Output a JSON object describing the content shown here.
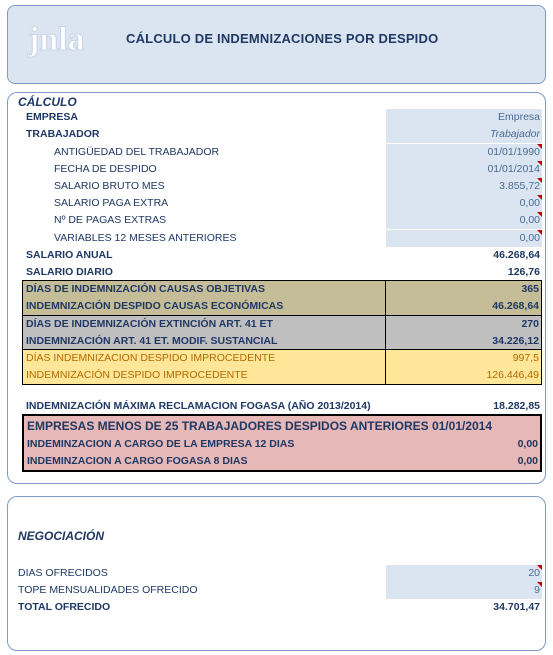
{
  "header": {
    "logo_text": "jnla",
    "title": "CÁLCULO DE INDEMNIZACIONES POR DESPIDO"
  },
  "calc": {
    "title": "CÁLCULO",
    "empresa_label": "EMPRESA",
    "empresa_value": "Empresa",
    "trabajador_label": "TRABAJADOR",
    "trabajador_value": "Trabajador",
    "antiguedad_label": "ANTIGÜEDAD DEL TRABAJADOR",
    "antiguedad_value": "01/01/1990",
    "fecha_label": "FECHA DE DESPIDO",
    "fecha_value": "01/01/2014",
    "salario_bruto_label": "SALARIO BRUTO MES",
    "salario_bruto_value": "3.855,72",
    "paga_extra_label": "SALARIO PAGA EXTRA",
    "paga_extra_value": "0,00",
    "num_pagas_label": "Nº DE PAGAS EXTRAS",
    "num_pagas_value": "0,00",
    "variables_label": "VARIABLES 12 MESES ANTERIORES",
    "variables_value": "0,00",
    "salario_anual_label": "SALARIO ANUAL",
    "salario_anual_value": "46.268,64",
    "salario_diario_label": "SALARIO DIARIO",
    "salario_diario_value": "126,76",
    "objetivas_dias_label": "DÍAS DE INDEMNIZACIÓN CAUSAS OBJETIVAS",
    "objetivas_dias_value": "365",
    "objetivas_ind_label": "INDEMNIZACIÓN DESPIDO CAUSAS ECONÓMICAS",
    "objetivas_ind_value": "46.268,64",
    "art41_dias_label": "DÍAS DE INDEMNIZACIÓN EXTINCIÓN ART. 41 ET",
    "art41_dias_value": "270",
    "art41_ind_label": "INDEMNIZACIÓN ART. 41 ET. MODIF. SUSTANCIAL",
    "art41_ind_value": "34.226,12",
    "improc_dias_label": "DÍAS INDEMNIZACION DESPIDO IMPROCEDENTE",
    "improc_dias_value": "997,5",
    "improc_ind_label": "INDEMNIZACIÓN DESPIDO IMPROCEDENTE",
    "improc_ind_value": "126.446,49",
    "fogasa_label": "INDEMNIZACIÓN MÁXIMA RECLAMACION FOGASA (AÑO 2013/2014)",
    "fogasa_value": "18.282,85",
    "pequenas_title": "EMPRESAS MENOS DE 25 TRABAJADORES DESPIDOS ANTERIORES 01/01/2014",
    "pequenas_empresa_label": "INDEMINZACION A CARGO DE LA EMPRESA 12 DIAS",
    "pequenas_empresa_value": "0,00",
    "pequenas_fogasa_label": "INDEMINZACION A CARGO FOGASA 8 DIAS",
    "pequenas_fogasa_value": "0,00"
  },
  "negociacion": {
    "title": "NEGOCIACIÓN",
    "dias_label": "DIAS OFRECIDOS",
    "dias_value": "20",
    "tope_label": "TOPE MENSUALIDADES OFRECIDO",
    "tope_value": "9",
    "total_label": "TOTAL OFRECIDO",
    "total_value": "34.701,47"
  },
  "colors": {
    "accent": "#1f3864",
    "input_bg": "#dbe5f1",
    "objetivas_bg": "#c4bd97",
    "art41_bg": "#bfbfbf",
    "improc_bg": "#ffe699",
    "pequenas_bg": "#e6b8b7",
    "note_mark": "#c00000"
  }
}
